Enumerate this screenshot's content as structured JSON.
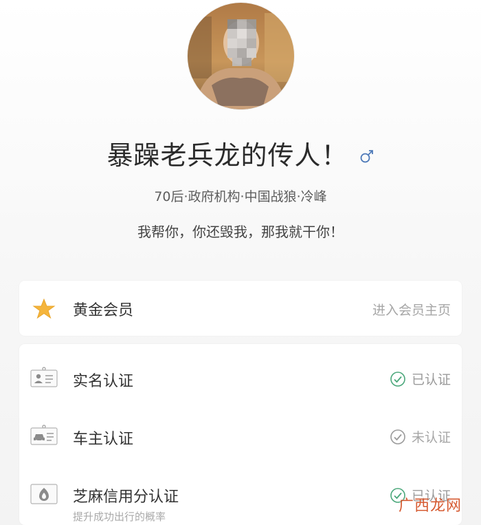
{
  "profile": {
    "name": "暴躁老兵龙的传人！",
    "gender_icon": "male-symbol-icon",
    "tags": "70后·政府机构·中国战狼·冷峰",
    "bio": "我帮你，你还毁我，那我就干你！"
  },
  "membership": {
    "icon": "star-icon",
    "label": "黄金会员",
    "link_text": "进入会员主页"
  },
  "verifications": [
    {
      "icon": "id-card-icon",
      "label": "实名认证",
      "status": "已认证",
      "status_icon": "check-circle-icon",
      "status_color": "#4aa77a"
    },
    {
      "icon": "car-owner-icon",
      "label": "车主认证",
      "status": "未认证",
      "status_icon": "check-circle-icon",
      "status_color": "#9a9a9a"
    },
    {
      "icon": "sesame-credit-icon",
      "label": "芝麻信用分认证",
      "sublabel": "提升成功出行的概率",
      "status": "已认证",
      "status_icon": "check-circle-icon",
      "status_color": "#4aa77a"
    }
  ],
  "colors": {
    "accent_green": "#4aa77a",
    "star_gold": "#f5b53c",
    "gender_blue": "#4d79b8",
    "watermark": "#d24a1c"
  },
  "watermark_text": "广西龙网"
}
